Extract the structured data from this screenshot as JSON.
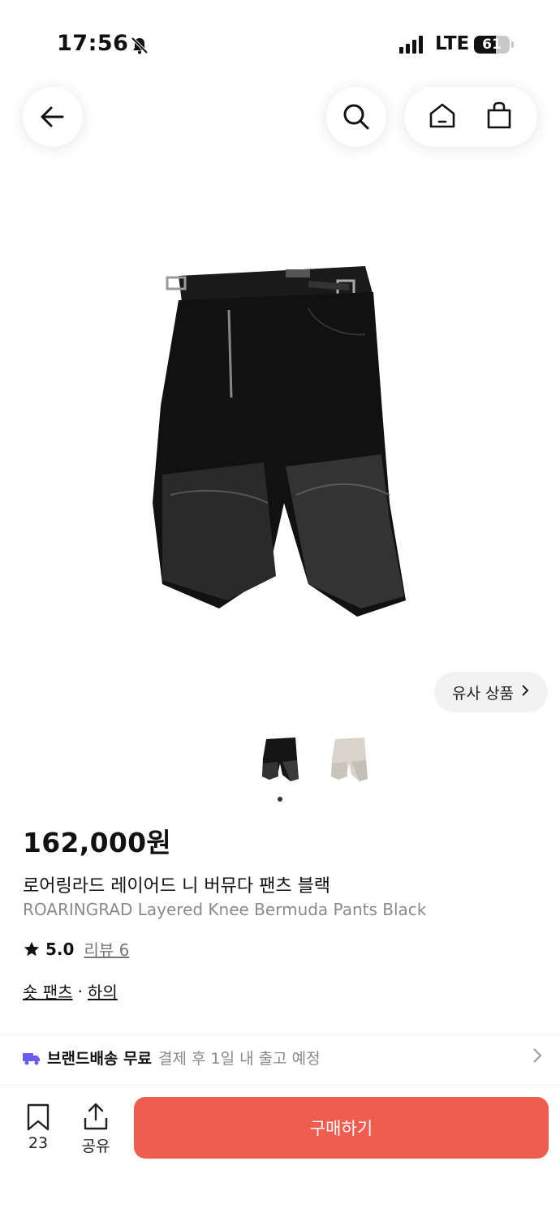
{
  "status": {
    "time": "17:56",
    "network": "LTE",
    "battery_level": 0.61,
    "battery_label": "61"
  },
  "nav": {
    "icons": [
      "back-arrow-icon",
      "search-icon",
      "home-icon",
      "shopping-bag-icon"
    ]
  },
  "similar": {
    "label": "유사 상품"
  },
  "gallery": {
    "count": 2,
    "active_index": 0
  },
  "product": {
    "price": "162,000원",
    "name_kr": "로어링라드 레이어드 니 버뮤다 팬츠 블랙",
    "name_en": "ROARINGRAD Layered Knee Bermuda Pants Black",
    "rating": "5.0",
    "review_label": "리뷰 6",
    "category_1": "숏 팬츠",
    "category_sep": "·",
    "category_2": "하의"
  },
  "delivery": {
    "label": "브랜드배송 무료",
    "detail": "결제 후 1일 내 출고 예정"
  },
  "bottom": {
    "bookmark_count": "23",
    "share_label": "공유",
    "buy_label": "구매하기"
  },
  "colors": {
    "accent": "#ef5d4f",
    "truck": "#6a5cf0",
    "muted_text": "#8a8a8a"
  }
}
